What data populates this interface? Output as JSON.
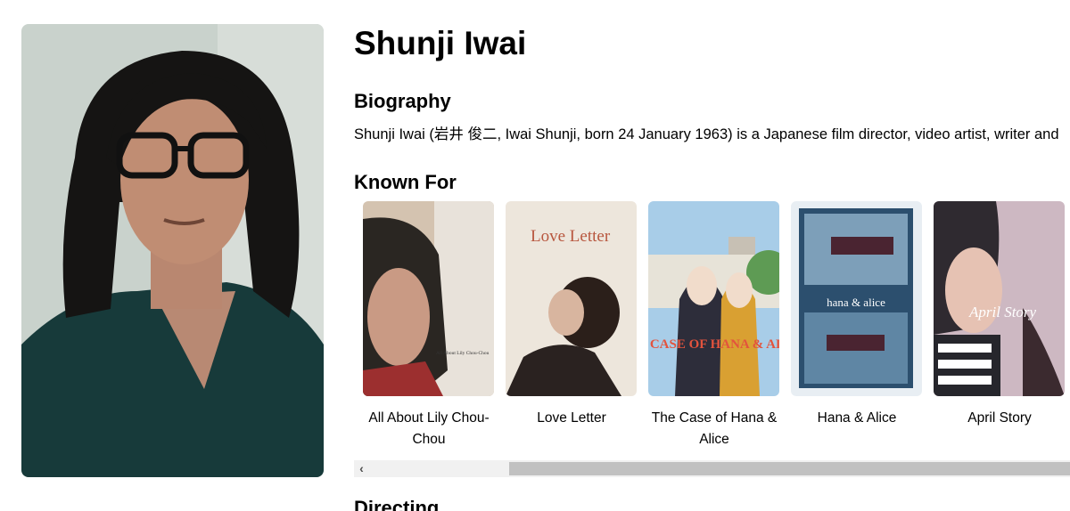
{
  "person": {
    "name": "Shunji Iwai",
    "photo_alt": "Shunji Iwai"
  },
  "biography": {
    "heading": "Biography",
    "text": "Shunji Iwai (岩井 俊二, Iwai Shunji, born 24 January 1963) is a Japanese film director, video artist, writer and"
  },
  "known_for": {
    "heading": "Known For",
    "items": [
      {
        "title": "All About Lily Chou-Chou",
        "poster_text": "All About Lily Chou-Chou"
      },
      {
        "title": "Love Letter",
        "poster_text": "Love Letter"
      },
      {
        "title": "The Case of Hana & Alice",
        "poster_text": "THE CASE OF HANA & ALICE"
      },
      {
        "title": "Hana & Alice",
        "poster_text": "hana & alice"
      },
      {
        "title": "April Story",
        "poster_text": "April Story"
      }
    ]
  },
  "directing": {
    "heading": "Directing"
  },
  "scrollbar": {
    "left_arrow": "‹"
  }
}
